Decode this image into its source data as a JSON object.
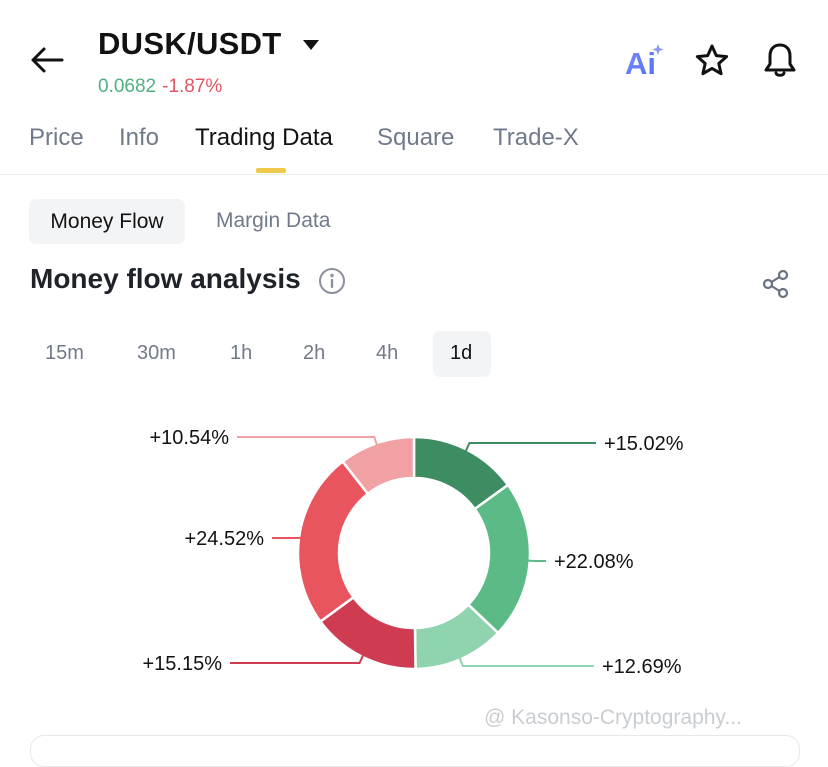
{
  "header": {
    "pair": "DUSK/USDT",
    "last_price": "0.0682",
    "change_pct": "-1.87%",
    "ai_label": "Ai"
  },
  "tabs": [
    {
      "label": "Price",
      "active": false
    },
    {
      "label": "Info",
      "active": false
    },
    {
      "label": "Trading Data",
      "active": true
    },
    {
      "label": "Square",
      "active": false
    },
    {
      "label": "Trade-X",
      "active": false
    }
  ],
  "subtabs": [
    {
      "label": "Money Flow",
      "active": true
    },
    {
      "label": "Margin Data",
      "active": false
    }
  ],
  "section": {
    "title": "Money flow analysis"
  },
  "timeframes": [
    {
      "label": "15m",
      "active": false
    },
    {
      "label": "30m",
      "active": false
    },
    {
      "label": "1h",
      "active": false
    },
    {
      "label": "2h",
      "active": false
    },
    {
      "label": "4h",
      "active": false
    },
    {
      "label": "1d",
      "active": true
    }
  ],
  "chart_data": {
    "type": "pie",
    "labels": [
      "+15.02%",
      "+22.08%",
      "+12.69%",
      "+15.15%",
      "+24.52%",
      "+10.54%"
    ],
    "values": [
      15.02,
      22.08,
      12.69,
      15.15,
      24.52,
      10.54
    ],
    "colors": [
      "#3e8c62",
      "#5cba87",
      "#8fd4ae",
      "#cf3c51",
      "#e8555f",
      "#f1a0a4"
    ]
  },
  "watermark": "@ Kasonso-Cryptography..."
}
